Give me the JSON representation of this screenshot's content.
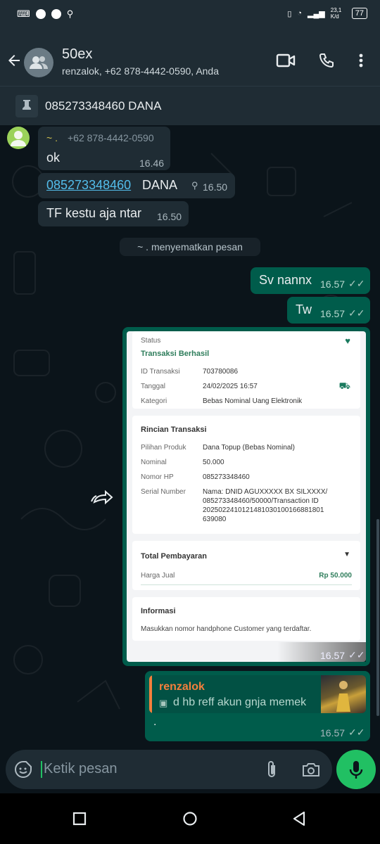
{
  "status_bar": {
    "battery": "77",
    "network": "23,1 K/d"
  },
  "header": {
    "title": "50ex",
    "subtitle": "renzalok, +62 878-4442-0590, Anda"
  },
  "pinned": {
    "text": "085273348460 DANA"
  },
  "messages": {
    "m1": {
      "sender": "~ .",
      "sender_phone": "+62 878-4442-0590",
      "text": "ok",
      "time": "16.46"
    },
    "m2": {
      "link": "085273348460",
      "text": "DANA",
      "time": "16.50"
    },
    "m3": {
      "text": "TF kestu aja ntar",
      "time": "16.50"
    },
    "system": "~ . menyematkan pesan",
    "m4": {
      "text": "Sv nannx",
      "time": "16.57"
    },
    "m5": {
      "text": "Tw",
      "time": "16.57"
    },
    "m6": {
      "time": "16.57"
    },
    "m7": {
      "quoted_author": "renzalok",
      "quoted_text": "d hb reff akun gnja memek",
      "text": ".",
      "time": "16.57"
    }
  },
  "receipt": {
    "status_label": "Status",
    "status_value": "Transaksi Berhasil",
    "id_label": "ID Transaksi",
    "id_value": "703780086",
    "date_label": "Tanggal",
    "date_value": "24/02/2025 16:57",
    "category_label": "Kategori",
    "category_value": "Bebas Nominal Uang Elektronik",
    "detail_title": "Rincian Transaksi",
    "product_label": "Pilihan Produk",
    "product_value": "Dana Topup (Bebas Nominal)",
    "nominal_label": "Nominal",
    "nominal_value": "50.000",
    "phone_label": "Nomor HP",
    "phone_value": "085273348460",
    "serial_label": "Serial Number",
    "serial_value_1": "Nama: DNID AGUXXXXX BX SILXXXX/",
    "serial_value_2": "085273348460/50000/Transaction ID",
    "serial_value_3": "2025022410121481030100166881801",
    "serial_value_4": "639080",
    "total_title": "Total Pembayaran",
    "price_label": "Harga Jual",
    "price_value": "Rp 50.000",
    "info_title": "Informasi",
    "info_text": "Masukkan nomor handphone Customer yang terdaftar."
  },
  "composer": {
    "placeholder": "Ketik pesan"
  },
  "colors": {
    "accent": "#21c063",
    "outgoing": "#005c4b",
    "incoming": "#1f2c34"
  }
}
